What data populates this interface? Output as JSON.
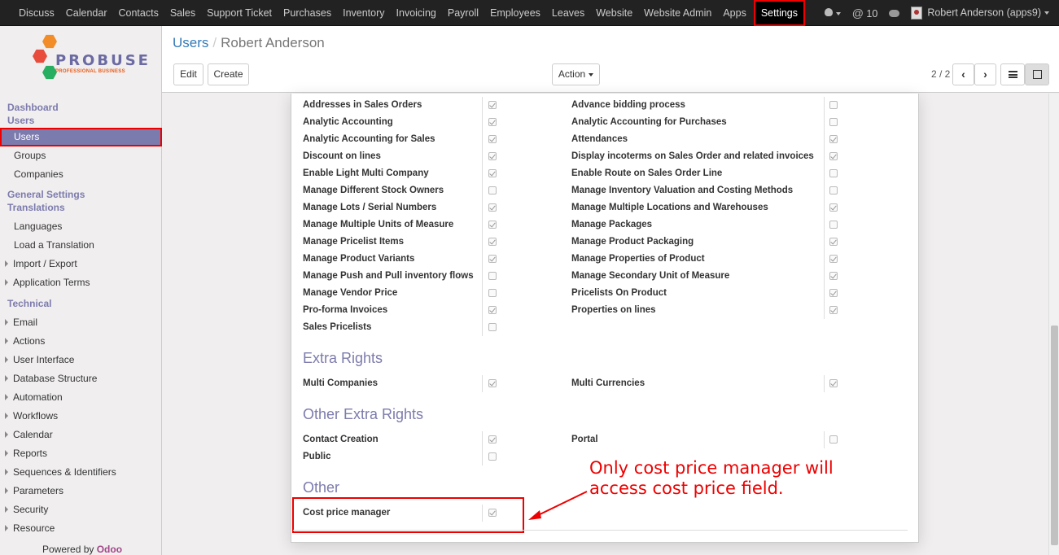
{
  "topbar": {
    "menu": [
      "Discuss",
      "Calendar",
      "Contacts",
      "Sales",
      "Support Ticket",
      "Purchases",
      "Inventory",
      "Invoicing",
      "Payroll",
      "Employees",
      "Leaves",
      "Website",
      "Website Admin",
      "Apps",
      "Settings"
    ],
    "active": "Settings",
    "messages_count": "10",
    "user": "Robert Anderson (apps9)"
  },
  "logo": {
    "name": "PROBUSE",
    "tagline": "PROFESSIONAL BUSINESS"
  },
  "sidebar": {
    "dashboard": "Dashboard",
    "users_header": "Users",
    "users": "Users",
    "groups": "Groups",
    "companies": "Companies",
    "general_settings": "General Settings",
    "translations": "Translations",
    "languages": "Languages",
    "load_translation": "Load a Translation",
    "import_export": "Import / Export",
    "application_terms": "Application Terms",
    "technical": "Technical",
    "email": "Email",
    "actions": "Actions",
    "user_interface": "User Interface",
    "database_structure": "Database Structure",
    "automation": "Automation",
    "workflows": "Workflows",
    "calendar": "Calendar",
    "reports": "Reports",
    "sequences": "Sequences & Identifiers",
    "parameters": "Parameters",
    "security": "Security",
    "resource": "Resource",
    "powered_by": "Powered by",
    "odoo": "Odoo"
  },
  "control": {
    "breadcrumb_parent": "Users",
    "breadcrumb_current": "Robert Anderson",
    "edit": "Edit",
    "create": "Create",
    "action": "Action",
    "pager": "2 / 2"
  },
  "rights_left": [
    {
      "label": "Addresses in Sales Orders",
      "checked": true
    },
    {
      "label": "Analytic Accounting",
      "checked": true
    },
    {
      "label": "Analytic Accounting for Sales",
      "checked": true
    },
    {
      "label": "Discount on lines",
      "checked": true
    },
    {
      "label": "Enable Light Multi Company",
      "checked": true
    },
    {
      "label": "Manage Different Stock Owners",
      "checked": false
    },
    {
      "label": "Manage Lots / Serial Numbers",
      "checked": true
    },
    {
      "label": "Manage Multiple Units of Measure",
      "checked": true
    },
    {
      "label": "Manage Pricelist Items",
      "checked": true
    },
    {
      "label": "Manage Product Variants",
      "checked": true
    },
    {
      "label": "Manage Push and Pull inventory flows",
      "checked": false
    },
    {
      "label": "Manage Vendor Price",
      "checked": false
    },
    {
      "label": "Pro-forma Invoices",
      "checked": true
    },
    {
      "label": "Sales Pricelists",
      "checked": false
    }
  ],
  "rights_right": [
    {
      "label": "Advance bidding process",
      "checked": false
    },
    {
      "label": "Analytic Accounting for Purchases",
      "checked": false
    },
    {
      "label": "Attendances",
      "checked": true
    },
    {
      "label": "Display incoterms on Sales Order and related invoices",
      "checked": true
    },
    {
      "label": "Enable Route on Sales Order Line",
      "checked": false
    },
    {
      "label": "Manage Inventory Valuation and Costing Methods",
      "checked": false
    },
    {
      "label": "Manage Multiple Locations and Warehouses",
      "checked": true
    },
    {
      "label": "Manage Packages",
      "checked": false
    },
    {
      "label": "Manage Product Packaging",
      "checked": true
    },
    {
      "label": "Manage Properties of Product",
      "checked": true
    },
    {
      "label": "Manage Secondary Unit of Measure",
      "checked": true
    },
    {
      "label": "Pricelists On Product",
      "checked": true
    },
    {
      "label": "Properties on lines",
      "checked": true
    }
  ],
  "extra_rights": {
    "title": "Extra Rights",
    "left": {
      "label": "Multi Companies",
      "checked": true
    },
    "right": {
      "label": "Multi Currencies",
      "checked": true
    }
  },
  "other_extra_rights": {
    "title": "Other Extra Rights",
    "contact_creation": {
      "label": "Contact Creation",
      "checked": true
    },
    "portal": {
      "label": "Portal",
      "checked": false
    },
    "public": {
      "label": "Public",
      "checked": false
    }
  },
  "other": {
    "title": "Other",
    "cost_price_manager": {
      "label": "Cost price manager",
      "checked": true
    }
  },
  "annotation": {
    "line1": "Only cost price manager will",
    "line2": "access cost price field."
  },
  "colors": {
    "accent": "#7c7bad",
    "highlight": "#e00000",
    "link": "#337ab7"
  }
}
